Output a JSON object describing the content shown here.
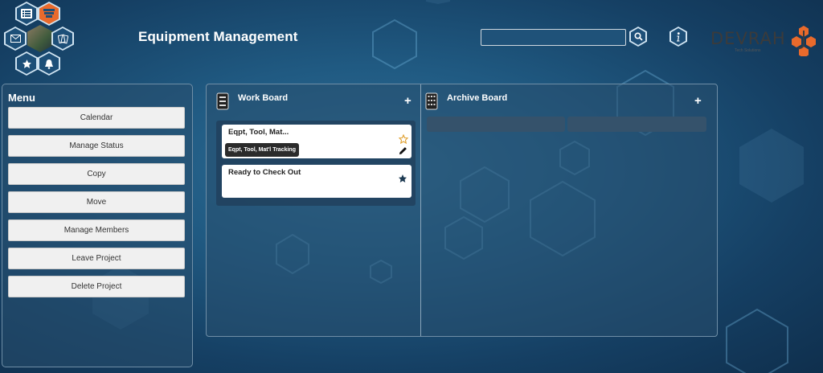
{
  "header": {
    "title": "Equipment Management",
    "search": {
      "value": "",
      "placeholder": ""
    },
    "logo": {
      "text": "DEVRAH",
      "tagline": "Tech Solutions"
    }
  },
  "nav_cluster": {
    "icons": [
      "list-icon",
      "stack-icon",
      "mail-icon",
      "avatar",
      "cards-icon",
      "star-icon",
      "bell-icon"
    ]
  },
  "menu": {
    "title": "Menu",
    "items": [
      {
        "label": "Calendar"
      },
      {
        "label": "Manage Status"
      },
      {
        "label": "Copy"
      },
      {
        "label": "Move"
      },
      {
        "label": "Manage Members"
      },
      {
        "label": "Leave Project"
      },
      {
        "label": "Delete Project"
      }
    ]
  },
  "boards": {
    "work": {
      "title": "Work Board",
      "add_label": "+",
      "cards": [
        {
          "title": "Eqpt, Tool, Mat...",
          "tooltip": "Eqpt, Tool, Mat'l Tracking",
          "starred": false
        },
        {
          "title": "Ready to Check Out",
          "starred": true
        }
      ]
    },
    "archive": {
      "title": "Archive Board",
      "add_label": "+"
    }
  },
  "colors": {
    "accent_orange": "#e86a2c",
    "panel_border": "#6f8ea6",
    "star_outline": "#e0a030",
    "star_filled": "#1d3a52"
  }
}
